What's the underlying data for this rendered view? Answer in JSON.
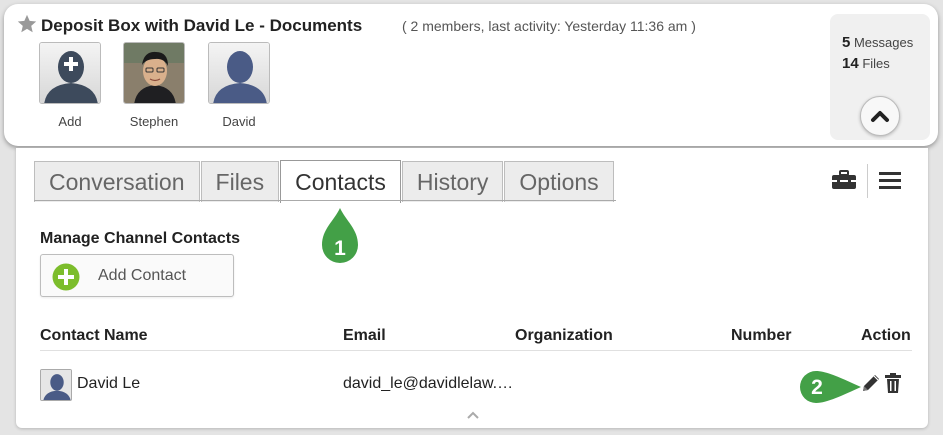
{
  "header": {
    "title": "Deposit Box with David Le - Documents",
    "meta": "( 2 members, last activity: Yesterday 11:36 am )",
    "members": [
      {
        "label": "Add"
      },
      {
        "label": "Stephen"
      },
      {
        "label": "David"
      }
    ],
    "stats": {
      "messages_count": "5",
      "messages_label": "Messages",
      "files_count": "14",
      "files_label": "Files"
    }
  },
  "tabs": [
    {
      "label": "Conversation",
      "active": false
    },
    {
      "label": "Files",
      "active": false
    },
    {
      "label": "Contacts",
      "active": true
    },
    {
      "label": "History",
      "active": false
    },
    {
      "label": "Options",
      "active": false
    }
  ],
  "contacts": {
    "section_title": "Manage Channel Contacts",
    "add_button_label": "Add Contact",
    "columns": [
      "Contact Name",
      "Email",
      "Organization",
      "Number",
      "Action"
    ],
    "rows": [
      {
        "name": "David Le",
        "email": "david_le@davidlelaw.…",
        "organization": "",
        "number": ""
      }
    ]
  },
  "annotations": [
    {
      "number": "1"
    },
    {
      "number": "2"
    }
  ],
  "icons": {
    "star": "star-icon",
    "collapse": "chevron-up-icon",
    "toolbox": "toolbox-icon",
    "menu": "hamburger-menu-icon",
    "add": "plus-circle-icon",
    "edit": "pencil-icon",
    "delete": "trash-icon",
    "scroll": "chevron-up-icon"
  },
  "colors": {
    "badge_green": "#43a047",
    "add_icon_green": "#7cbd2c",
    "active_tab": "#ffffff",
    "inactive_tab": "#ececec"
  }
}
